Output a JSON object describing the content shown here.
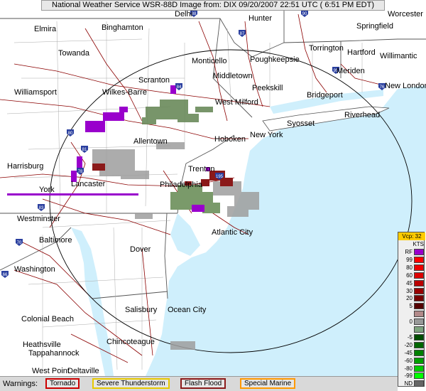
{
  "title": "National Weather Service WSR-88D Image  from: DIX  09/20/2007  22:51 UTC  ( 6:51 PM EDT)",
  "cities": [
    {
      "name": "Delhi"
    },
    {
      "name": "Hunter"
    },
    {
      "name": "Worcester"
    },
    {
      "name": "Elmira"
    },
    {
      "name": "Binghamton"
    },
    {
      "name": "Springfield"
    },
    {
      "name": "Towanda"
    },
    {
      "name": "Monticello"
    },
    {
      "name": "Poughkeepsie"
    },
    {
      "name": "Torrington"
    },
    {
      "name": "Hartford"
    },
    {
      "name": "Willimantic"
    },
    {
      "name": "Middletown"
    },
    {
      "name": "Meriden"
    },
    {
      "name": "Scranton"
    },
    {
      "name": "Peekskill"
    },
    {
      "name": "New London"
    },
    {
      "name": "Williamsport"
    },
    {
      "name": "Wilkes-Barre"
    },
    {
      "name": "Bridgeport"
    },
    {
      "name": "West Milford"
    },
    {
      "name": "Riverhead"
    },
    {
      "name": "Syosset"
    },
    {
      "name": "Hoboken"
    },
    {
      "name": "New York"
    },
    {
      "name": "Allentown"
    },
    {
      "name": "Harrisburg"
    },
    {
      "name": "Trenton"
    },
    {
      "name": "Lancaster"
    },
    {
      "name": "York"
    },
    {
      "name": "Philadelphia"
    },
    {
      "name": "Westminster"
    },
    {
      "name": "Atlantic City"
    },
    {
      "name": "Baltimore"
    },
    {
      "name": "Dover"
    },
    {
      "name": "Washington"
    },
    {
      "name": "Salisbury"
    },
    {
      "name": "Ocean City"
    },
    {
      "name": "Colonial Beach"
    },
    {
      "name": "Chincoteague"
    },
    {
      "name": "Heathsville"
    },
    {
      "name": "Tappahannock"
    },
    {
      "name": "West Point"
    },
    {
      "name": "Deltaville"
    }
  ],
  "interstates": [
    "88",
    "90",
    "87",
    "84",
    "80",
    "81",
    "78",
    "76",
    "195",
    "83",
    "70",
    "95",
    "66"
  ],
  "legend": {
    "header": "Vcp: 32",
    "unit": "KTS",
    "rows": [
      {
        "label": "RF",
        "color": "#9900cc"
      },
      {
        "label": "99",
        "color": "#ff0000"
      },
      {
        "label": "80",
        "color": "#ee0000"
      },
      {
        "label": "60",
        "color": "#dd0000"
      },
      {
        "label": "45",
        "color": "#bb0000"
      },
      {
        "label": "30",
        "color": "#990000"
      },
      {
        "label": "20",
        "color": "#770000"
      },
      {
        "label": "5",
        "color": "#550000"
      },
      {
        "label": "",
        "color": "#b38a8a"
      },
      {
        "label": "0",
        "color": "#999999"
      },
      {
        "label": "",
        "color": "#7fa37f"
      },
      {
        "label": "-5",
        "color": "#004d00"
      },
      {
        "label": "-20",
        "color": "#006600"
      },
      {
        "label": "-45",
        "color": "#008000"
      },
      {
        "label": "-60",
        "color": "#00a000"
      },
      {
        "label": "-80",
        "color": "#00cc00"
      },
      {
        "label": "-99",
        "color": "#00ff00"
      },
      {
        "label": "ND",
        "color": "#666666"
      }
    ]
  },
  "warnings": {
    "label": "Warnings:",
    "items": [
      {
        "label": "Tornado",
        "color": "#cc0000"
      },
      {
        "label": "Severe Thunderstorm",
        "color": "#e6c800"
      },
      {
        "label": "Flash Flood",
        "color": "#8b1a1a"
      },
      {
        "label": "Special Marine",
        "color": "#ff9900"
      }
    ]
  },
  "colors": {
    "ocean": "#cfeffc",
    "land": "#ffffff",
    "roads": "#8b0000",
    "borders": "#555555",
    "range_ring": "#000000"
  }
}
